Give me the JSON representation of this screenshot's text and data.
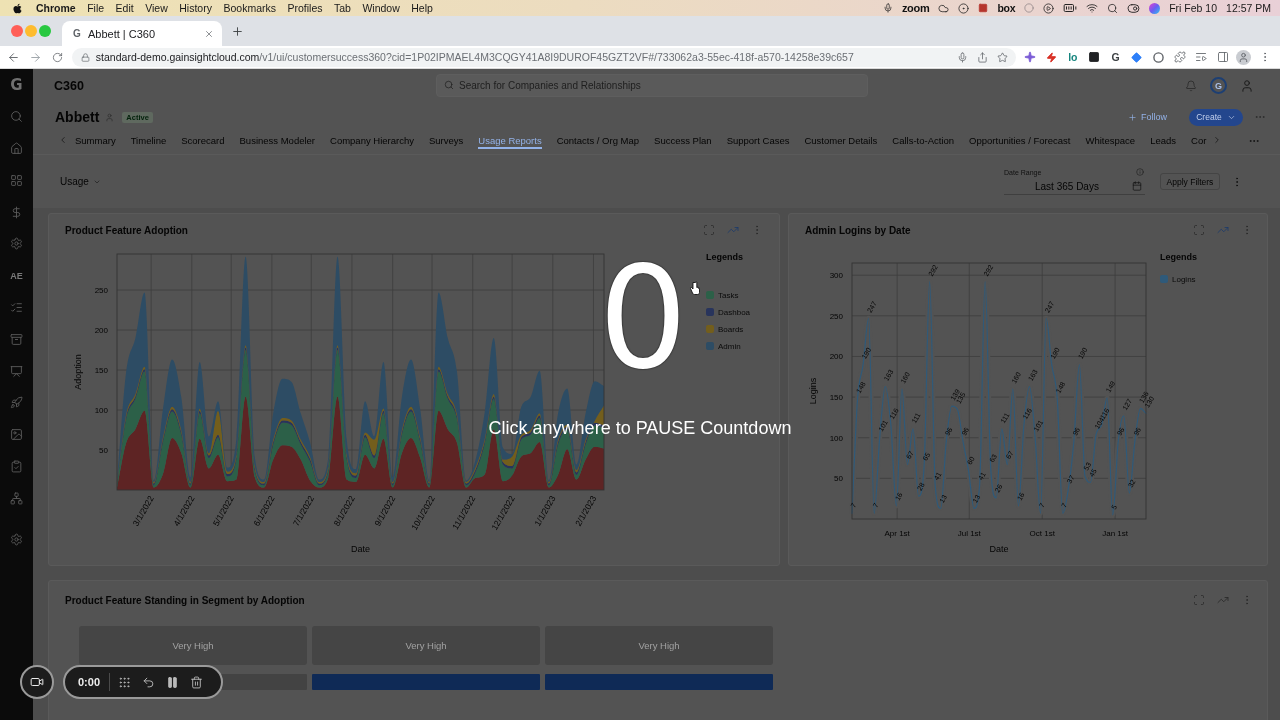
{
  "menu_bar": {
    "app": "Chrome",
    "menus": [
      "File",
      "Edit",
      "View",
      "History",
      "Bookmarks",
      "Profiles",
      "Tab",
      "Window",
      "Help"
    ],
    "status_texts": [
      "zoom",
      "box"
    ],
    "date": "Fri Feb 10",
    "time": "12:57 PM"
  },
  "browser": {
    "tab": {
      "favicon": "G",
      "title": "Abbett | C360"
    },
    "url": {
      "host": "standard-demo.gainsightcloud.com",
      "path": "/v1/ui/customersuccess360?cid=1P02IPMAEL4M3CQGY41A8I9DUROF45GZT2VF#/733062a3-55ec-418f-a570-14258e39c657"
    },
    "extension_texts": [
      "lo",
      "G"
    ]
  },
  "sidebar": {
    "logo": "G",
    "initials": "AE"
  },
  "header": {
    "title": "C360",
    "search": {
      "placeholder": "Search for Companies and Relationships"
    },
    "avatar": "G"
  },
  "company": {
    "name": "Abbett",
    "status": "Active",
    "follow": "Follow",
    "create": "Create"
  },
  "tabs": [
    {
      "label": "Summary",
      "selected": false
    },
    {
      "label": "Timeline",
      "selected": false
    },
    {
      "label": "Scorecard",
      "selected": false
    },
    {
      "label": "Business Modeler",
      "selected": false
    },
    {
      "label": "Company Hierarchy",
      "selected": false
    },
    {
      "label": "Surveys",
      "selected": false
    },
    {
      "label": "Usage Reports",
      "selected": true
    },
    {
      "label": "Contacts / Org Map",
      "selected": false
    },
    {
      "label": "Success Plan",
      "selected": false
    },
    {
      "label": "Support Cases",
      "selected": false
    },
    {
      "label": "Customer Details",
      "selected": false
    },
    {
      "label": "Calls-to-Action",
      "selected": false
    },
    {
      "label": "Opportunities / Forecast",
      "selected": false
    },
    {
      "label": "Whitespace",
      "selected": false
    },
    {
      "label": "Leads",
      "selected": false
    },
    {
      "label": "Cor",
      "selected": false
    }
  ],
  "filters": {
    "view": "Usage",
    "date_range": {
      "label": "Date Range",
      "value": "Last 365 Days"
    },
    "apply": "Apply Filters"
  },
  "cards": [
    {
      "kind": "chart",
      "chart_data": {
        "type": "area",
        "stacked": true,
        "title": "Product Feature Adoption",
        "xlabel": "Date",
        "ylabel": "Adoption",
        "legend_title": "Legends",
        "legend": "right",
        "grid": true,
        "x": [
          "2022-02-03",
          "2022-02-10",
          "2022-02-17",
          "2022-02-24",
          "2022-03-03",
          "2022-03-10",
          "2022-03-17",
          "2022-03-24",
          "2022-03-31",
          "2022-04-07",
          "2022-04-14",
          "2022-04-21",
          "2022-04-28",
          "2022-05-05",
          "2022-05-12",
          "2022-05-19",
          "2022-05-26",
          "2022-06-02",
          "2022-06-09",
          "2022-06-16",
          "2022-06-23",
          "2022-06-30",
          "2022-07-07",
          "2022-07-14",
          "2022-07-21",
          "2022-07-28",
          "2022-08-04",
          "2022-08-11",
          "2022-08-18",
          "2022-08-25",
          "2022-09-01",
          "2022-09-08",
          "2022-09-15",
          "2022-09-22",
          "2022-09-29",
          "2022-10-06",
          "2022-10-13",
          "2022-10-20",
          "2022-10-27",
          "2022-11-03",
          "2022-11-10",
          "2022-11-17",
          "2022-11-24",
          "2022-12-01",
          "2022-12-08",
          "2022-12-15",
          "2022-12-22",
          "2022-12-29",
          "2023-01-05",
          "2023-01-12",
          "2023-01-19",
          "2023-01-26",
          "2023-02-02",
          "2023-02-09"
        ],
        "xlim": [
          "2022-02-03",
          "2023-02-09"
        ],
        "xticks": [
          {
            "value": "2022-03-01",
            "label": "3/1/2022"
          },
          {
            "value": "2022-04-01",
            "label": "4/1/2022"
          },
          {
            "value": "2022-05-01",
            "label": "5/1/2022"
          },
          {
            "value": "2022-06-01",
            "label": "6/1/2022"
          },
          {
            "value": "2022-07-01",
            "label": "7/1/2022"
          },
          {
            "value": "2022-08-01",
            "label": "8/1/2022"
          },
          {
            "value": "2022-09-01",
            "label": "9/1/2022"
          },
          {
            "value": "2022-10-01",
            "label": "10/1/2022"
          },
          {
            "value": "2022-11-01",
            "label": "11/1/2022"
          },
          {
            "value": "2022-12-01",
            "label": "12/1/2022"
          },
          {
            "value": "2023-01-01",
            "label": "1/1/2023"
          },
          {
            "value": "2023-02-01",
            "label": "2/1/2023"
          }
        ],
        "ylim": [
          0,
          295
        ],
        "yticks": [
          50,
          100,
          150,
          200,
          250
        ],
        "series": [
          {
            "color": "#5e2424",
            "values": [
              3,
              59,
              76,
              99,
              3,
              20,
              65,
              46,
              3,
              64,
              27,
              44,
              11,
              13,
              117,
              16,
              3,
              38,
              56,
              54,
              38,
              12,
              3,
              16,
              117,
              13,
              10,
              44,
              27,
              64,
              3,
              46,
              65,
              40,
              3,
              99,
              76,
              59,
              3,
              15,
              19,
              76,
              11,
              18,
              42,
              46,
              60,
              3,
              19,
              51,
              13,
              38,
              54,
              52
            ]
          },
          {
            "name": "Tasks",
            "color": "#2c6048",
            "values": [
              3,
              30,
              38,
              49,
              3,
              40,
              33,
              23,
              3,
              32,
              13,
              22,
              6,
              26,
              58,
              8,
              3,
              19,
              28,
              27,
              19,
              24,
              3,
              8,
              58,
              25,
              5,
              22,
              13,
              32,
              3,
              23,
              33,
              20,
              3,
              49,
              38,
              30,
              3,
              7,
              38,
              38,
              21,
              9,
              21,
              23,
              30,
              3,
              38,
              25,
              6,
              19,
              27,
              26
            ]
          },
          {
            "name": "Dashboa",
            "color": "#28345c",
            "values": [
              2,
              3,
              3,
              3,
              2,
              3,
              3,
              3,
              2,
              3,
              3,
              3,
              3,
              3,
              3,
              3,
              2,
              3,
              3,
              3,
              3,
              3,
              2,
              3,
              3,
              3,
              3,
              3,
              3,
              3,
              2,
              3,
              3,
              3,
              2,
              3,
              3,
              3,
              2,
              3,
              3,
              3,
              3,
              3,
              3,
              3,
              3,
              2,
              3,
              3,
              3,
              3,
              3,
              3
            ]
          },
          {
            "name": "Boards",
            "color": "#735e1c",
            "values": [
              2,
              3,
              3,
              3,
              2,
              3,
              3,
              3,
              2,
              3,
              3,
              30,
              3,
              3,
              3,
              3,
              2,
              3,
              3,
              3,
              3,
              3,
              2,
              3,
              3,
              3,
              3,
              3,
              20,
              3,
              2,
              3,
              3,
              3,
              2,
              3,
              3,
              3,
              2,
              3,
              3,
              3,
              3,
              12,
              3,
              3,
              3,
              2,
              3,
              3,
              3,
              3,
              3,
              25
            ]
          },
          {
            "name": "Admin",
            "color": "#2d4c64",
            "values": [
              2,
              53,
              70,
              93,
              2,
              35,
              59,
              41,
              6,
              58,
              21,
              12,
              5,
              20,
              111,
              11,
              3,
              33,
              49,
              48,
              33,
              18,
              3,
              11,
              111,
              19,
              5,
              39,
              4,
              58,
              6,
              41,
              59,
              35,
              2,
              93,
              70,
              53,
              2,
              9,
              33,
              70,
              15,
              3,
              35,
              41,
              53,
              2,
              33,
              45,
              7,
              33,
              49,
              24
            ]
          }
        ]
      }
    },
    {
      "kind": "chart",
      "chart_data": {
        "type": "line",
        "title": "Admin Logins by Date",
        "xlabel": "Date",
        "ylabel": "Logins",
        "legend_title": "Legends",
        "legend": "right",
        "grid": true,
        "data_labels": true,
        "x": [
          "2022-02-03",
          "2022-02-10",
          "2022-02-17",
          "2022-02-24",
          "2022-03-03",
          "2022-03-10",
          "2022-03-17",
          "2022-03-24",
          "2022-03-31",
          "2022-04-07",
          "2022-04-14",
          "2022-04-21",
          "2022-04-28",
          "2022-05-05",
          "2022-05-12",
          "2022-05-19",
          "2022-05-26",
          "2022-06-02",
          "2022-06-09",
          "2022-06-16",
          "2022-06-23",
          "2022-06-30",
          "2022-07-07",
          "2022-07-14",
          "2022-07-21",
          "2022-07-28",
          "2022-08-04",
          "2022-08-11",
          "2022-08-18",
          "2022-08-25",
          "2022-09-01",
          "2022-09-08",
          "2022-09-15",
          "2022-09-22",
          "2022-09-29",
          "2022-10-06",
          "2022-10-13",
          "2022-10-20",
          "2022-10-27",
          "2022-11-03",
          "2022-11-10",
          "2022-11-17",
          "2022-11-24",
          "2022-12-01",
          "2022-12-08",
          "2022-12-15",
          "2022-12-22",
          "2022-12-29",
          "2023-01-05",
          "2023-01-12",
          "2023-01-19",
          "2023-01-26",
          "2023-02-02",
          "2023-02-09"
        ],
        "xlim": [
          "2022-02-03",
          "2023-02-09"
        ],
        "xticks": [
          {
            "value": "2022-04-01",
            "label": "Apr 1st"
          },
          {
            "value": "2022-07-01",
            "label": "Jul 1st"
          },
          {
            "value": "2022-10-01",
            "label": "Oct 1st"
          },
          {
            "value": "2023-01-01",
            "label": "Jan 1st"
          }
        ],
        "ylim": [
          0,
          315
        ],
        "yticks": [
          50,
          100,
          150,
          200,
          250,
          300
        ],
        "series": [
          {
            "name": "Logins",
            "color": "#2f5a7a",
            "values": [
              7,
              148,
              190,
              247,
              7,
              101,
              163,
              116,
              16,
              160,
              67,
              111,
              28,
              65,
              292,
              41,
              13,
              96,
              139,
              135,
              96,
              60,
              13,
              41,
              292,
              63,
              26,
              111,
              67,
              160,
              16,
              116,
              163,
              101,
              7,
              247,
              190,
              148,
              7,
              37,
              96,
              190,
              53,
              45,
              104,
              116,
              149,
              5,
              96,
              127,
              32,
              96,
              136,
              130
            ]
          }
        ]
      }
    },
    {
      "kind": "standing",
      "title": "Product Feature Standing in Segment by Adoption",
      "columns": [
        {
          "heading": "Very High",
          "color": "#434343"
        },
        {
          "heading": "Very High",
          "color": "#0f2a56"
        },
        {
          "heading": "Very High",
          "color": "#0f2a56"
        }
      ]
    }
  ],
  "recorder": {
    "elapsed": "0:00"
  },
  "countdown": {
    "value": "0",
    "message": "Click anywhere to PAUSE Countdown"
  }
}
